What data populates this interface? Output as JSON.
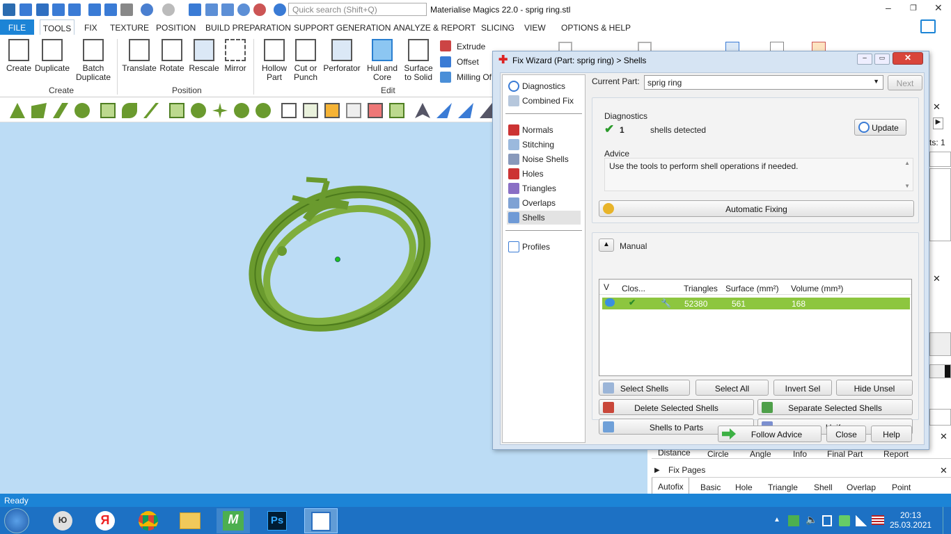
{
  "app": {
    "title": "Materialise Magics 22.0 - sprig ring.stl",
    "search_placeholder": "Quick search (Shift+Q)"
  },
  "menu": [
    "FILE",
    "TOOLS",
    "FIX",
    "TEXTURE",
    "POSITION",
    "BUILD PREPARATION",
    "SUPPORT GENERATION",
    "ANALYZE & REPORT",
    "SLICING",
    "VIEW",
    "OPTIONS & HELP"
  ],
  "ribbon": {
    "buttons": [
      {
        "label": "Create"
      },
      {
        "label": "Duplicate"
      },
      {
        "label": "Batch\nDuplicate"
      },
      {
        "label": "Translate"
      },
      {
        "label": "Rotate"
      },
      {
        "label": "Rescale"
      },
      {
        "label": "Mirror"
      },
      {
        "label": "Hollow\nPart"
      },
      {
        "label": "Cut or\nPunch"
      },
      {
        "label": "Perforator"
      },
      {
        "label": "Hull and\nCore"
      },
      {
        "label": "Surface\nto Solid"
      }
    ],
    "small": [
      "Extrude",
      "Offset",
      "Milling Of"
    ],
    "groups": [
      "Create",
      "Position",
      "Edit"
    ]
  },
  "dialog": {
    "title": "Fix Wizard (Part: sprig ring) > Shells",
    "nav": [
      {
        "label": "Diagnostics"
      },
      {
        "label": "Combined Fix"
      },
      {
        "label": "Normals"
      },
      {
        "label": "Stitching"
      },
      {
        "label": "Noise Shells"
      },
      {
        "label": "Holes"
      },
      {
        "label": "Triangles"
      },
      {
        "label": "Overlaps"
      },
      {
        "label": "Shells"
      },
      {
        "label": "Profiles"
      }
    ],
    "current_part_label": "Current Part:",
    "current_part_value": "sprig ring",
    "next_label": "Next",
    "diagnostics_label": "Diagnostics",
    "shell_count": "1",
    "shells_detected": "shells detected",
    "update_label": "Update",
    "advice_label": "Advice",
    "advice_text": "Use the tools to perform shell operations if needed.",
    "automatic_fixing": "Automatic Fixing",
    "manual_label": "Manual",
    "grid_headers": [
      "V",
      "Clos...",
      "Triangles",
      "Surface (mm²)",
      "Volume (mm³)"
    ],
    "grid_row": {
      "triangles": "52380",
      "surface": "561",
      "volume": "168"
    },
    "buttons": {
      "select_shells": "Select Shells",
      "select_all": "Select All",
      "invert_sel": "Invert Sel",
      "hide_unsel": "Hide Unsel",
      "delete_selected": "Delete Selected Shells",
      "separate_selected": "Separate Selected Shells",
      "shells_to_parts": "Shells to Parts",
      "unify": "Unify",
      "follow_advice": "Follow Advice",
      "close": "Close",
      "help": "Help"
    }
  },
  "right": {
    "parts_fragment": "ts: 1",
    "measure_tabs": [
      "Distance",
      "Circle",
      "Angle",
      "Info",
      "Final Part",
      "Report"
    ],
    "fix_pages": "Fix Pages",
    "fix_tabs": [
      "Autofix",
      "Basic",
      "Hole",
      "Triangle",
      "Shell",
      "Overlap",
      "Point"
    ]
  },
  "status": "Ready",
  "clock": {
    "time": "20:13",
    "date": "25.03.2021"
  },
  "colors": {
    "accent": "#1c84d6",
    "selected_row": "#8dc63f",
    "model": "#6a9a2e"
  }
}
